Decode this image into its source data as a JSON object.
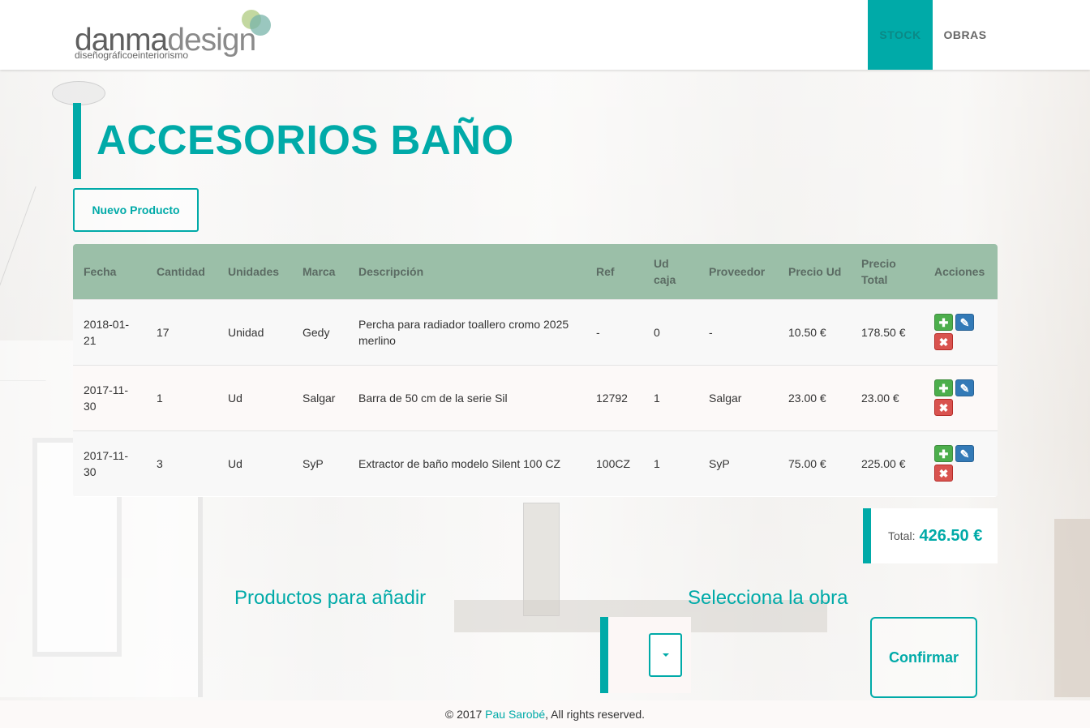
{
  "nav": {
    "logo_main_1": "danma",
    "logo_main_2": "design",
    "logo_tagline": "diseñográficoeinteriorismo",
    "tabs": [
      {
        "label": "STOCK",
        "active": true
      },
      {
        "label": "OBRAS",
        "active": false
      }
    ]
  },
  "page": {
    "title": "ACCESORIOS BAÑO",
    "new_product_label": "Nuevo Producto"
  },
  "table": {
    "headers": [
      "Fecha",
      "Cantidad",
      "Unidades",
      "Marca",
      "Descripción",
      "Ref",
      "Ud caja",
      "Proveedor",
      "Precio Ud",
      "Precio Total",
      "Acciones"
    ],
    "rows": [
      {
        "fecha": "2018-01-21",
        "cantidad": "17",
        "unidades": "Unidad",
        "marca": "Gedy",
        "descripcion": "Percha para radiador toallero cromo 2025 merlino",
        "ref": "-",
        "ud_caja": "0",
        "proveedor": "-",
        "precio_ud": "10.50 €",
        "precio_total": "178.50 €"
      },
      {
        "fecha": "2017-11-30",
        "cantidad": "1",
        "unidades": "Ud",
        "marca": "Salgar",
        "descripcion": "Barra de 50 cm de la serie Sil",
        "ref": "12792",
        "ud_caja": "1",
        "proveedor": "Salgar",
        "precio_ud": "23.00 €",
        "precio_total": "23.00 €"
      },
      {
        "fecha": "2017-11-30",
        "cantidad": "3",
        "unidades": "Ud",
        "marca": "SyP",
        "descripcion": "Extractor de baño modelo Silent 100 CZ",
        "ref": "100CZ",
        "ud_caja": "1",
        "proveedor": "SyP",
        "precio_ud": "75.00 €",
        "precio_total": "225.00 €"
      }
    ],
    "action_icons": {
      "add": "plus-icon",
      "edit": "pencil-icon",
      "delete": "remove-icon"
    }
  },
  "summary": {
    "total_label": "Total:",
    "total_value": "426.50 €"
  },
  "sections": {
    "products_heading": "Productos para añadir",
    "obra_heading": "Selecciona la obra",
    "confirm_label": "Confirmar"
  },
  "footer": {
    "prefix": "© 2017 ",
    "author": "Pau Sarobé",
    "suffix": ", All rights reserved."
  },
  "colors": {
    "accent": "#00aaa8",
    "table_header": "#9bbfa8",
    "add": "#4cae4c",
    "edit": "#337ab7",
    "delete": "#d9534f"
  }
}
